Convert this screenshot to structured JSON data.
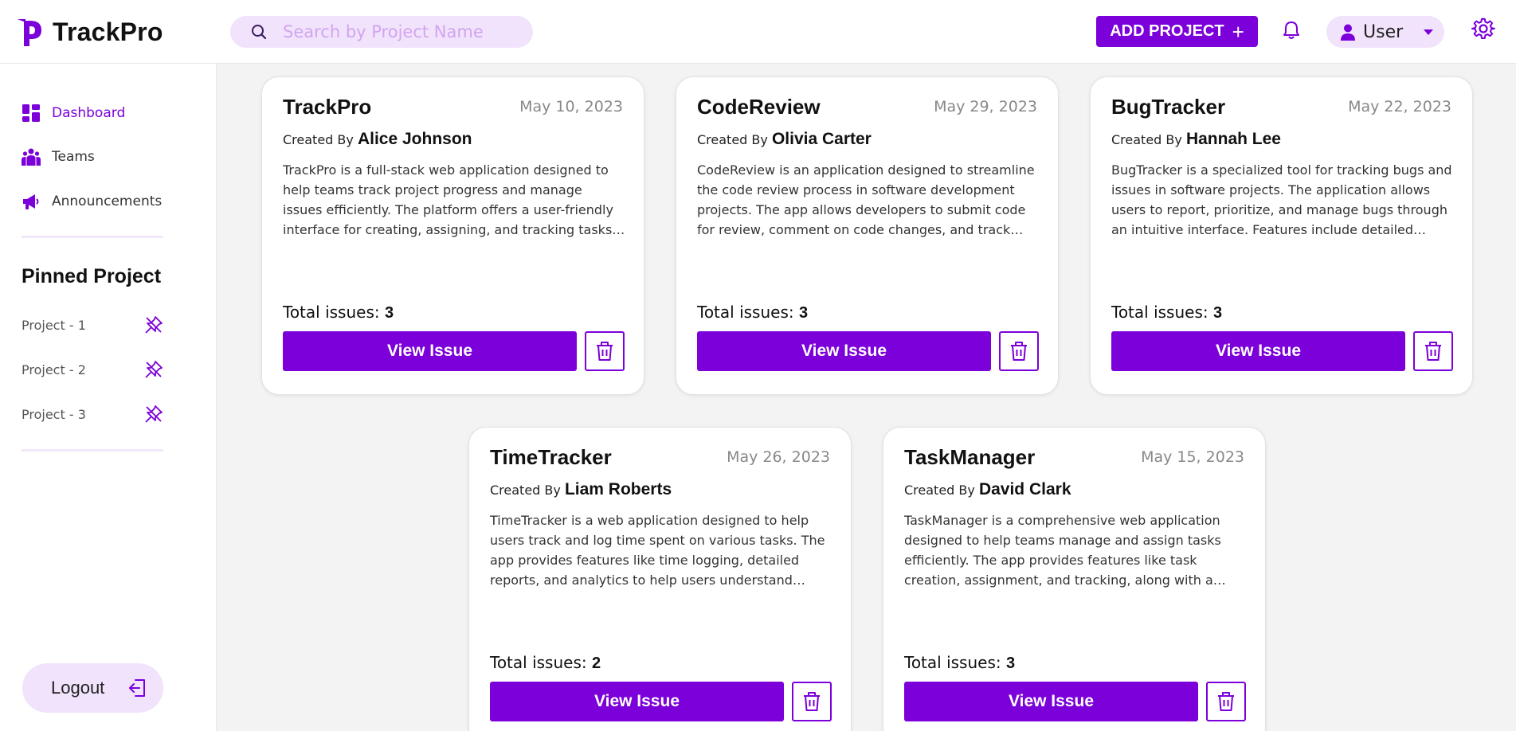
{
  "app": {
    "name": "TrackPro"
  },
  "search": {
    "placeholder": "Search by Project Name",
    "value": ""
  },
  "header": {
    "add_project_label": "ADD PROJECT",
    "user_label": "User"
  },
  "sidebar": {
    "nav": [
      {
        "label": "Dashboard",
        "icon": "dashboard-icon",
        "active": true
      },
      {
        "label": "Teams",
        "icon": "teams-icon",
        "active": false
      },
      {
        "label": "Announcements",
        "icon": "megaphone-icon",
        "active": false
      }
    ],
    "pinned_title": "Pinned Project",
    "pinned": [
      {
        "label": "Project - 1",
        "icon": "pin-icon"
      },
      {
        "label": "Project - 2",
        "icon": "pin-icon"
      },
      {
        "label": "Project - 3",
        "icon": "pin-icon"
      }
    ],
    "logout_label": "Logout"
  },
  "cards": [
    {
      "title": "TrackPro",
      "date": "May 10, 2023",
      "created_prefix": "Created By",
      "author": "Alice Johnson",
      "description": "TrackPro is a full-stack web application designed to help teams track project progress and manage issues efficiently. The platform offers a user-friendly interface for creating, assigning, and tracking tasks. It…",
      "total_label": "Total issues:",
      "total": "3",
      "view_label": "View Issue"
    },
    {
      "title": "CodeReview",
      "date": "May 29, 2023",
      "created_prefix": "Created By",
      "author": "Olivia Carter",
      "description": "CodeReview is an application designed to streamline the code review process in software development projects. The app allows developers to submit code for review, comment on code changes, and track…",
      "total_label": "Total issues:",
      "total": "3",
      "view_label": "View Issue"
    },
    {
      "title": "BugTracker",
      "date": "May 22, 2023",
      "created_prefix": "Created By",
      "author": "Hannah Lee",
      "description": "BugTracker is a specialized tool for tracking bugs and issues in software projects. The application allows users to report, prioritize, and manage bugs through an intuitive interface. Features include detailed bug…",
      "total_label": "Total issues:",
      "total": "3",
      "view_label": "View Issue"
    },
    {
      "title": "TimeTracker",
      "date": "May 26, 2023",
      "created_prefix": "Created By",
      "author": "Liam Roberts",
      "description": "TimeTracker is a web application designed to help users track and log time spent on various tasks. The app provides features like time logging, detailed reports, and analytics to help users understand their…",
      "total_label": "Total issues:",
      "total": "2",
      "view_label": "View Issue"
    },
    {
      "title": "TaskManager",
      "date": "May 15, 2023",
      "created_prefix": "Created By",
      "author": "David Clark",
      "description": "TaskManager is a comprehensive web application designed to help teams manage and assign tasks efficiently. The app provides features like task creation, assignment, and tracking, along with a…",
      "total_label": "Total issues:",
      "total": "3",
      "view_label": "View Issue"
    }
  ],
  "colors": {
    "accent": "#7b00d9",
    "accent_light": "#f0e3fb",
    "background": "#f3f3f3"
  }
}
